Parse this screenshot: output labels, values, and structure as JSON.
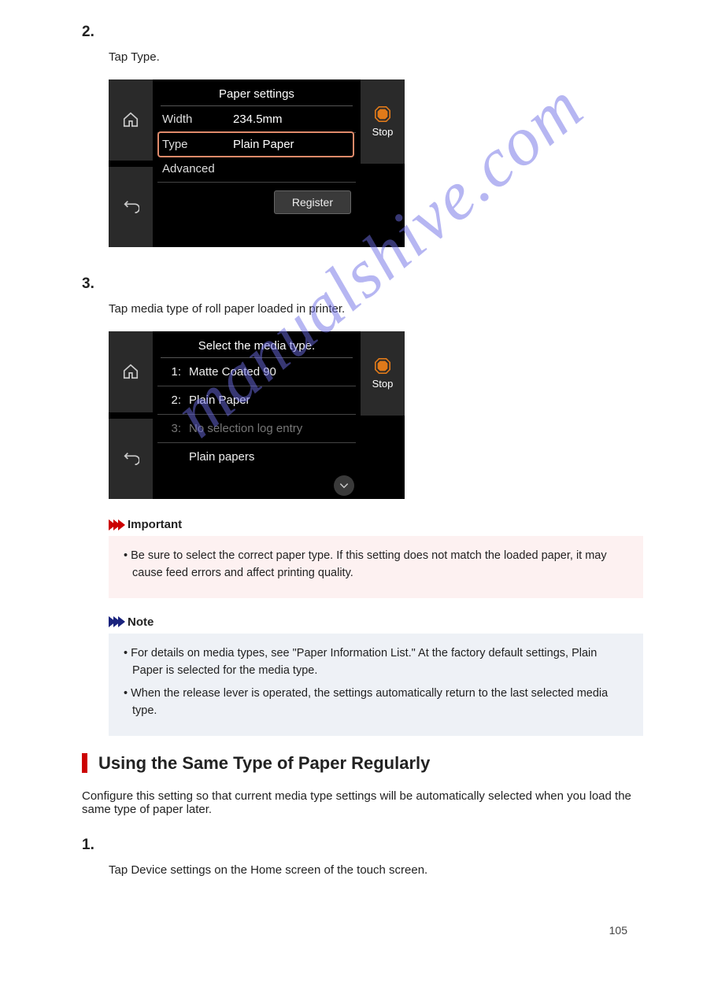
{
  "step2_num": "2.",
  "step2_text": "Tap Type.",
  "ts1": {
    "title": "Paper settings",
    "width_label": "Width",
    "width_value": "234.5mm",
    "type_label": "Type",
    "type_value": "Plain Paper",
    "advanced_label": "Advanced",
    "register_label": "Register",
    "stop_label": "Stop"
  },
  "step3_num": "3.",
  "step3_text": "Tap media type of roll paper loaded in printer.",
  "ts2": {
    "title": "Select the media type.",
    "item1_num": "1:",
    "item1_label": "Matte Coated 90",
    "item2_num": "2:",
    "item2_label": "Plain Paper",
    "item3_num": "3:",
    "item3_label": "No selection log entry",
    "item4_label": "Plain papers",
    "stop_label": "Stop"
  },
  "imp_label": "Important",
  "imp_line1": "• Be sure to select the correct paper type. If this setting does not match the loaded paper, it may cause feed errors and affect printing quality.",
  "note_label": "Note",
  "note_line1": "• For details on media types, see \"Paper Information List.\" At the factory default settings, Plain Paper is selected for the media type.",
  "note_line2": "• When the release lever is operated, the settings automatically return to the last selected media type.",
  "section_title": "Using the Same Type of Paper Regularly",
  "section_body": "Configure this setting so that current media type settings will be automatically selected when you load the same type of paper later.",
  "step1b_num": "1.",
  "step1b_text": "Tap Device settings on the Home screen of the touch screen.",
  "watermark": "manualshive.com",
  "page_number": "105"
}
